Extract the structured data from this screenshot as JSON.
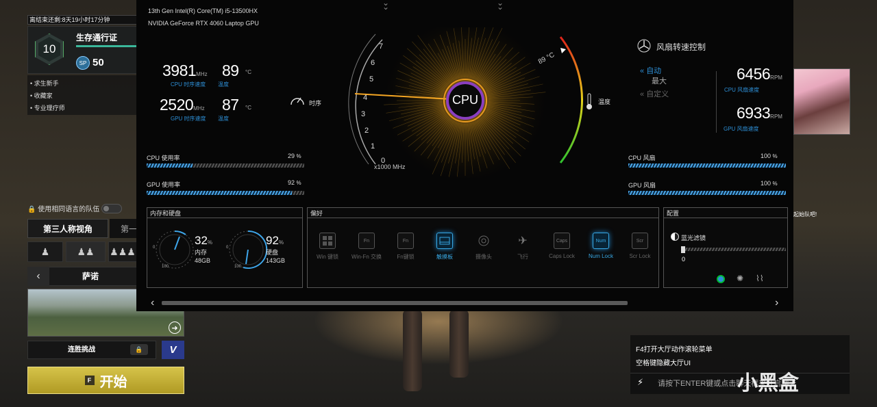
{
  "lobby": {
    "season_timer": "离结束还剩:8天19小时17分钟",
    "pass_level": "10",
    "pass_title": "生存通行证",
    "sp_icon": "SP",
    "sp_value": "50",
    "side_items": [
      "求生新手",
      "收藏家",
      "专业理疗师"
    ],
    "same_language_label": "使用相同语言的队伍",
    "perspective_tp": "第三人称视角",
    "perspective_fp": "第一",
    "map_name": "萨诺",
    "streak_label": "连胜挑战",
    "v_label": "V",
    "start_key": "F",
    "start_label": "开始",
    "chat_peek": "起始队吧!",
    "chat_lines": [
      "F4打开大厅动作滚轮菜单",
      "空格键隐藏大厅UI"
    ],
    "chat_placeholder": "请按下ENTER键或点击聊天框来开启聊天",
    "watermark": "小黑盒"
  },
  "overlay": {
    "cpu_model": "13th Gen Intel(R) Core(TM) i5-13500HX",
    "gpu_model": "NVIDIA GeForce RTX 4060 Laptop GPU",
    "cpu_freq": "3981",
    "cpu_freq_unit": "MHz",
    "cpu_freq_label": "CPU 时序速度",
    "cpu_temp": "89",
    "cpu_temp_unit": "°C",
    "cpu_temp_label": "温度",
    "gpu_freq": "2520",
    "gpu_freq_unit": "MHz",
    "gpu_freq_label": "GPU 时序速度",
    "gpu_temp": "87",
    "gpu_temp_unit": "°C",
    "gpu_temp_label": "温度",
    "clock_label": "时序",
    "temp_label": "温度",
    "gauge_center": "CPU",
    "gauge_ticks": [
      "7",
      "6",
      "5",
      "4",
      "3",
      "2",
      "1",
      "0"
    ],
    "gauge_unit": "x1000 MHz",
    "gauge_temp": "89 °C",
    "cpu_usage_label": "CPU 使用率",
    "cpu_usage": "29",
    "cpu_usage_unit": "%",
    "gpu_usage_label": "GPU 使用率",
    "gpu_usage": "92",
    "gpu_usage_unit": "%",
    "fan_title": "风扇转速控制",
    "fan_modes": [
      "自动",
      "最大",
      "自定义"
    ],
    "cpu_fan_rpm": "6456",
    "rpm_unit": "RPM",
    "cpu_fan_label": "CPU 风扇速度",
    "gpu_fan_rpm": "6933",
    "gpu_fan_label": "GPU 风扇速度",
    "cpu_fan_bar_label": "CPU 风扇",
    "cpu_fan_pct": "100",
    "fan_pct_unit": "%",
    "gpu_fan_bar_label": "GPU 风扇",
    "gpu_fan_pct": "100",
    "mem_box_title": "内存和硬盘",
    "mem_pct": "32",
    "mem_label": "内存",
    "mem_size": "48GB",
    "disk_pct": "92",
    "disk_label": "硬盘",
    "disk_size": "143GB",
    "dial_min": "0",
    "dial_max": "100",
    "pref_box_title": "偏好",
    "prefs": [
      {
        "label": "Win 键锁",
        "icon": "win-key-icon"
      },
      {
        "label": "Win-Fn 交换",
        "icon": "win-fn-swap-icon",
        "glyph": "Fn"
      },
      {
        "label": "Fn键锁",
        "icon": "fn-lock-icon",
        "glyph": "Fn"
      },
      {
        "label": "触摸板",
        "icon": "touchpad-icon"
      },
      {
        "label": "摄像头",
        "icon": "camera-icon"
      },
      {
        "label": "飞行",
        "icon": "airplane-icon"
      },
      {
        "label": "Caps Lock",
        "icon": "caps-lock-icon",
        "glyph": "Caps"
      },
      {
        "label": "Num Lock",
        "icon": "num-lock-icon",
        "glyph": "Num"
      },
      {
        "label": "Scr Lock",
        "icon": "scroll-lock-icon",
        "glyph": "Scr"
      }
    ],
    "config_box_title": "配置",
    "bluelight_label": "蓝光滤镜",
    "bluelight_value": "0",
    "colors": {
      "accent": "#2d8fd6",
      "active": "#38a9e6",
      "gauge_needle": "#f5a623"
    }
  }
}
